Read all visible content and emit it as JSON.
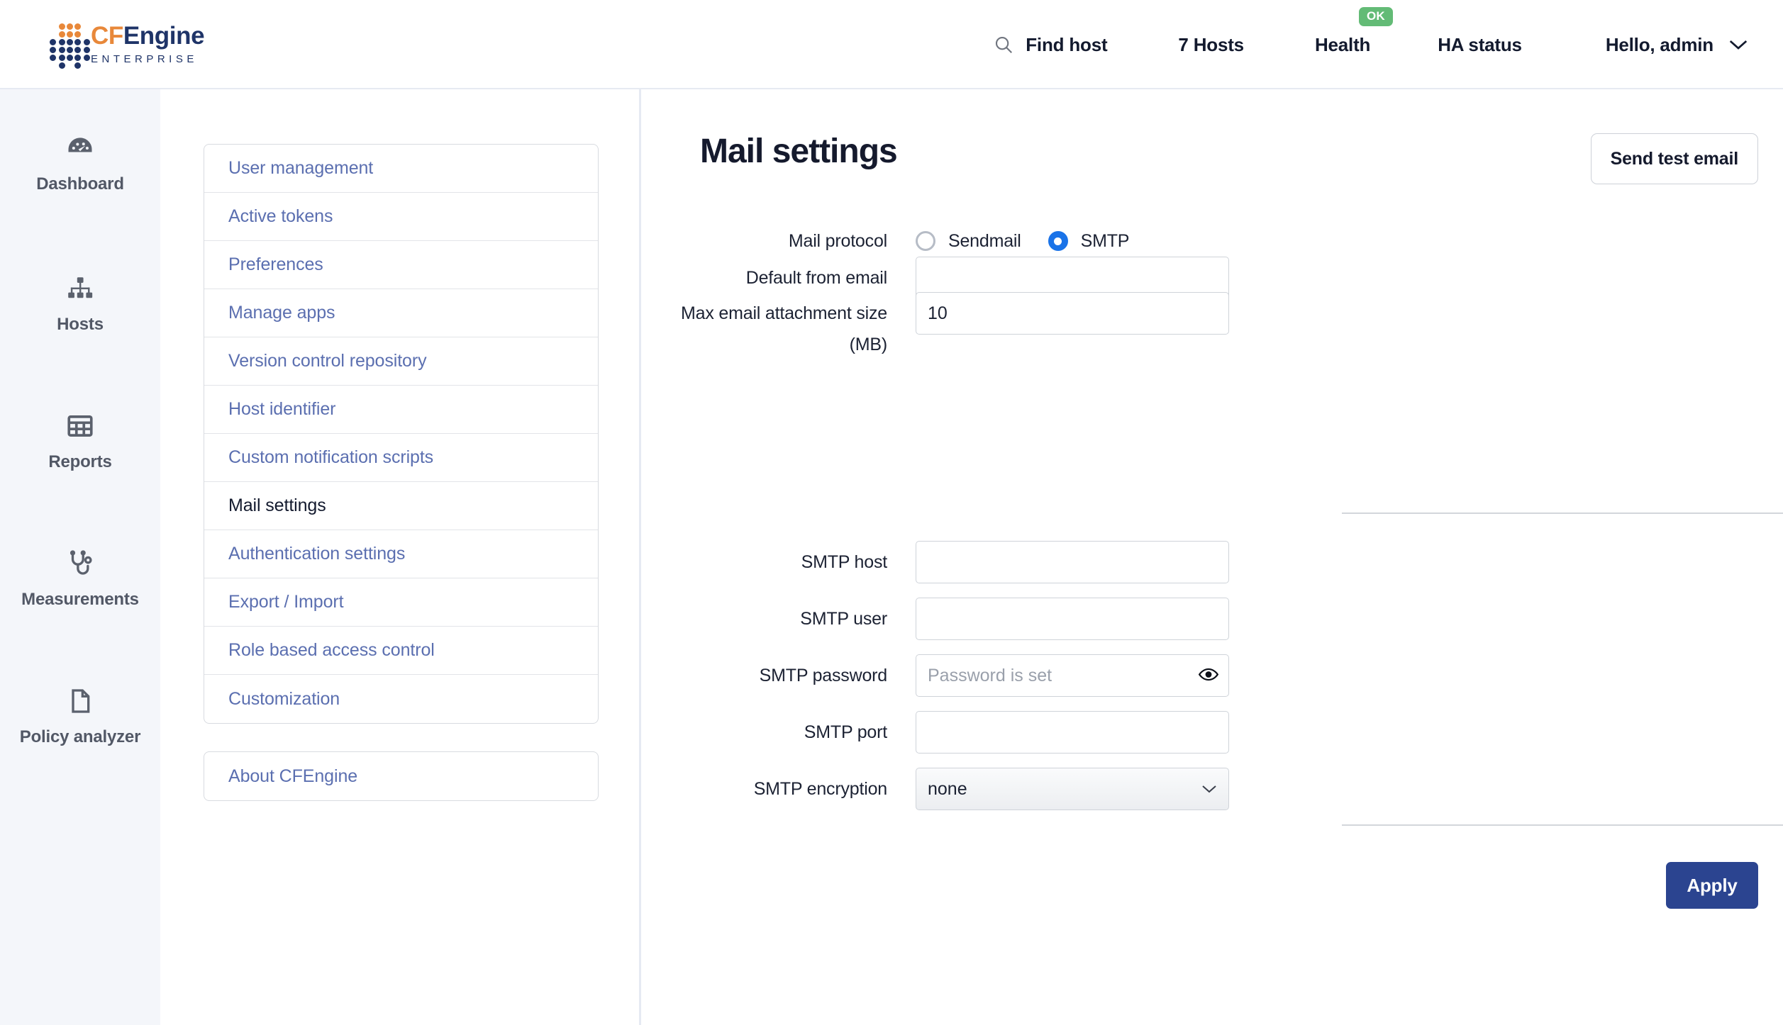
{
  "header": {
    "logo": {
      "prefix": "CF",
      "suffix": "Engine",
      "subtitle": "ENTERPRISE",
      "orange": "#e8883a",
      "navy": "#1f3468"
    },
    "nav": {
      "find_host": "Find host",
      "hosts_count": "7 Hosts",
      "health": "Health",
      "health_badge": "OK",
      "health_badge_color": "#63bb76",
      "ha_status": "HA status",
      "user_greeting": "Hello, admin"
    }
  },
  "sidebar": {
    "items": [
      {
        "label": "Dashboard",
        "icon": "gauge-icon"
      },
      {
        "label": "Hosts",
        "icon": "org-chart-icon"
      },
      {
        "label": "Reports",
        "icon": "table-grid-icon"
      },
      {
        "label": "Measurements",
        "icon": "stethoscope-icon"
      },
      {
        "label": "Policy analyzer",
        "icon": "document-icon"
      }
    ]
  },
  "settings_menu": {
    "items": [
      {
        "label": "User management",
        "active": false
      },
      {
        "label": "Active tokens",
        "active": false
      },
      {
        "label": "Preferences",
        "active": false
      },
      {
        "label": "Manage apps",
        "active": false
      },
      {
        "label": "Version control repository",
        "active": false
      },
      {
        "label": "Host identifier",
        "active": false
      },
      {
        "label": "Custom notification scripts",
        "active": false
      },
      {
        "label": "Mail settings",
        "active": true
      },
      {
        "label": "Authentication settings",
        "active": false
      },
      {
        "label": "Export / Import",
        "active": false
      },
      {
        "label": "Role based access control",
        "active": false
      },
      {
        "label": "Customization",
        "active": false
      }
    ],
    "about": "About CFEngine"
  },
  "main": {
    "title": "Mail settings",
    "send_test_button": "Send test email",
    "apply_button": "Apply",
    "apply_color": "#2b4490",
    "form": {
      "mail_protocol_label": "Mail protocol",
      "protocol_options": [
        {
          "label": "Sendmail",
          "selected": false
        },
        {
          "label": "SMTP",
          "selected": true
        }
      ],
      "selected_protocol": "SMTP",
      "radio_accent": "#1a73e8",
      "default_from_email_label": "Default from email",
      "default_from_email_value": "",
      "default_from_email_placeholder": "",
      "max_attachment_label": "Max email attachment size (MB)",
      "max_attachment_value": "10",
      "smtp_host_label": "SMTP host",
      "smtp_host_value": "",
      "smtp_user_label": "SMTP user",
      "smtp_user_value": "",
      "smtp_password_label": "SMTP password",
      "smtp_password_value": "",
      "smtp_password_placeholder": "Password is set",
      "smtp_port_label": "SMTP port",
      "smtp_port_value": "",
      "smtp_encryption_label": "SMTP encryption",
      "smtp_encryption_value": "none",
      "smtp_encryption_options": [
        "none"
      ]
    }
  }
}
